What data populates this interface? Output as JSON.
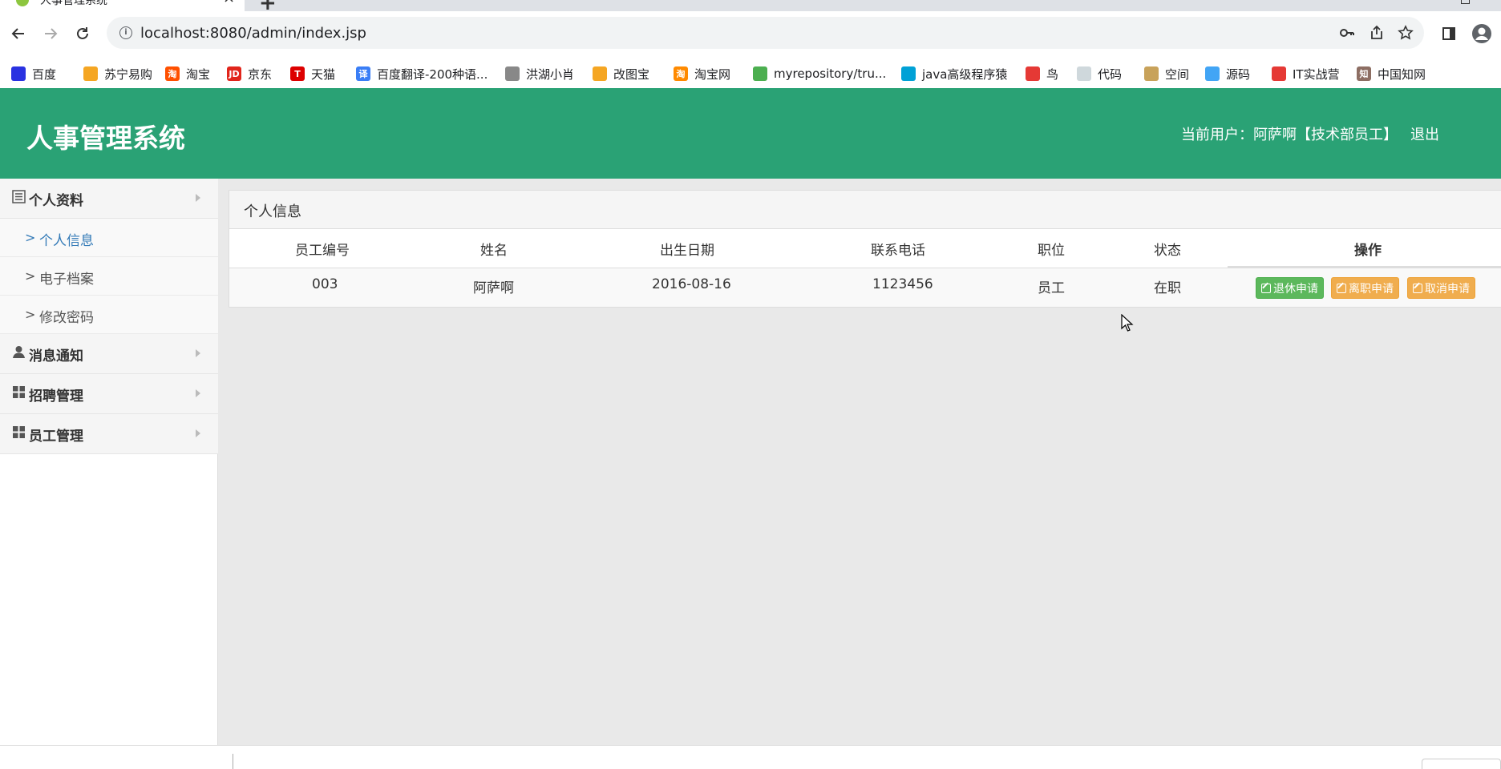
{
  "browser": {
    "tab_title": "人事管理系统",
    "tab_close": "×",
    "new_tab": "+",
    "url": "localhost:8080/admin/index.jsp",
    "bookmarks": [
      {
        "label": "百度",
        "icon": "paw-icon",
        "color": "#2932e1"
      },
      {
        "label": "苏宁易购",
        "icon": "lion-icon",
        "color": "#f5a623"
      },
      {
        "label": "淘宝",
        "icon": "taobao-icon",
        "color": "#ff5000",
        "glyph": "淘"
      },
      {
        "label": "京东",
        "icon": "jd-icon",
        "color": "#e1251b",
        "glyph": "JD"
      },
      {
        "label": "天猫",
        "icon": "tmall-icon",
        "color": "#d00",
        "glyph": "T"
      },
      {
        "label": "百度翻译-200种语...",
        "icon": "translate-icon",
        "color": "#3a7ef6",
        "glyph": "译"
      },
      {
        "label": "洪湖小肖",
        "icon": "bird-icon",
        "color": "#888"
      },
      {
        "label": "改图宝",
        "icon": "folder-icon",
        "color": "#f5a623"
      },
      {
        "label": "淘宝网",
        "icon": "taobao-icon",
        "color": "#ff8a00",
        "glyph": "淘"
      },
      {
        "label": "myrepository/tru...",
        "icon": "chrome-icon",
        "color": "#4caf50"
      },
      {
        "label": "java高级程序猿",
        "icon": "bilibili-icon",
        "color": "#00a1d6"
      },
      {
        "label": "鸟",
        "icon": "bird-red-icon",
        "color": "#e53935"
      },
      {
        "label": "代码",
        "icon": "leaf-icon",
        "color": "#cfd8dc"
      },
      {
        "label": "空间",
        "icon": "space-icon",
        "color": "#c8a25a"
      },
      {
        "label": "源码",
        "icon": "fish-icon",
        "color": "#42a5f5"
      },
      {
        "label": "IT实战营",
        "icon": "target-icon",
        "color": "#e53935"
      },
      {
        "label": "中国知网",
        "icon": "cnki-icon",
        "color": "#8d6e63",
        "glyph": "知"
      }
    ]
  },
  "app": {
    "title": "人事管理系统",
    "user_label": "当前用户：阿萨啊【技术部员工】",
    "logout": "退出"
  },
  "sidebar": {
    "groups": [
      {
        "label": "个人资料",
        "icon": "list-icon",
        "items": [
          {
            "label": "个人信息",
            "active": true
          },
          {
            "label": "电子档案",
            "active": false
          },
          {
            "label": "修改密码",
            "active": false
          }
        ]
      },
      {
        "label": "消息通知",
        "icon": "user-icon",
        "items": []
      },
      {
        "label": "招聘管理",
        "icon": "grid-icon",
        "items": []
      },
      {
        "label": "员工管理",
        "icon": "grid-icon",
        "items": []
      }
    ]
  },
  "main": {
    "panel_title": "个人信息",
    "columns": [
      "员工编号",
      "姓名",
      "出生日期",
      "联系电话",
      "职位",
      "状态",
      "操作"
    ],
    "row": {
      "id": "003",
      "name": "阿萨啊",
      "birth": "2016-08-16",
      "phone": "1123456",
      "position": "员工",
      "status": "在职"
    },
    "actions": {
      "retire": "退休申请",
      "resign": "离职申请",
      "cancel": "取消申请"
    }
  },
  "colors": {
    "header": "#2aa275",
    "btn_green": "#5cb85c",
    "btn_orange": "#f0ad4e",
    "active_link": "#337ab7"
  }
}
